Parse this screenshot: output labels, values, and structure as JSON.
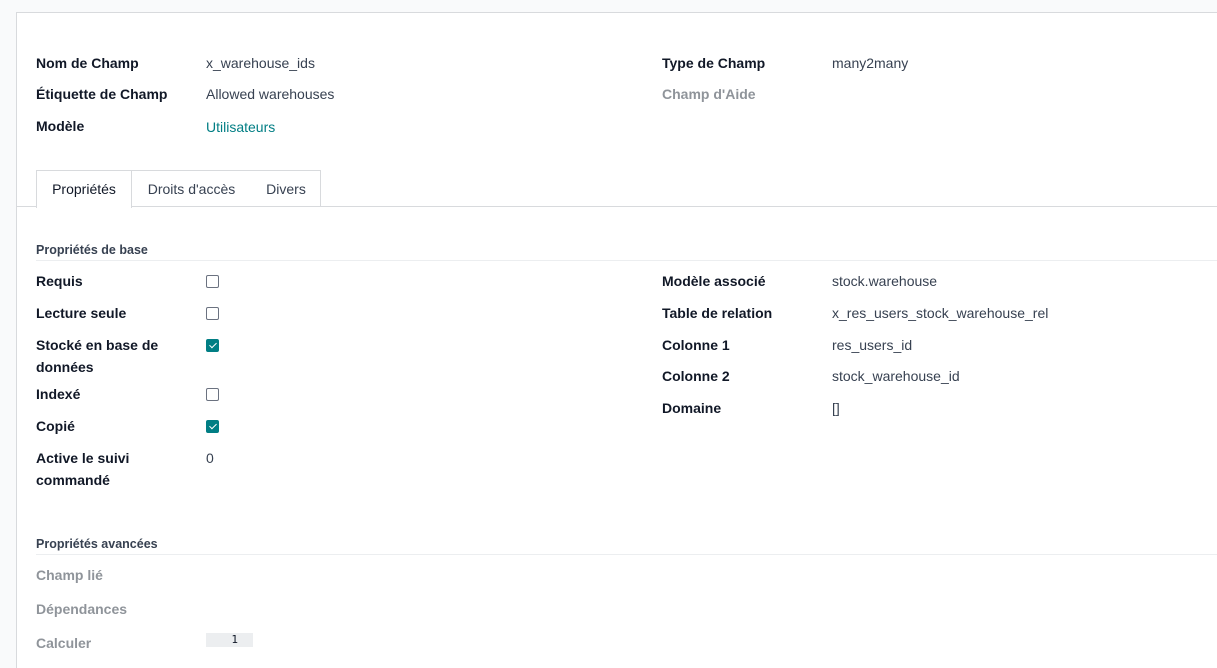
{
  "header_fields": {
    "field_name_label": "Nom de Champ",
    "field_name_value": "x_warehouse_ids",
    "field_label_label": "Étiquette de Champ",
    "field_label_value": "Allowed warehouses",
    "model_label": "Modèle",
    "model_value": "Utilisateurs",
    "field_type_label": "Type de Champ",
    "field_type_value": "many2many",
    "help_label": "Champ d'Aide"
  },
  "tabs": [
    {
      "label": "Propriétés",
      "active": true
    },
    {
      "label": "Droits d'accès",
      "active": false
    },
    {
      "label": "Divers",
      "active": false
    }
  ],
  "basic_properties": {
    "title": "Propriétés de base",
    "required": {
      "label": "Requis",
      "checked": false
    },
    "readonly": {
      "label": "Lecture seule",
      "checked": false
    },
    "stored": {
      "label_line1": "Stocké en base de",
      "label_line2": "données",
      "checked": true
    },
    "indexed": {
      "label": "Indexé",
      "checked": false
    },
    "copied": {
      "label": "Copié",
      "checked": true
    },
    "tracking": {
      "label_line1": "Active le suivi",
      "label_line2": "commandé",
      "value": "0"
    },
    "related_model_label": "Modèle associé",
    "related_model_value": "stock.warehouse",
    "relation_table_label": "Table de relation",
    "relation_table_value": "x_res_users_stock_warehouse_rel",
    "column1_label": "Colonne 1",
    "column1_value": "res_users_id",
    "column2_label": "Colonne 2",
    "column2_value": "stock_warehouse_id",
    "domain_label": "Domaine",
    "domain_value": "[]"
  },
  "advanced_properties": {
    "title": "Propriétés avancées",
    "related_field_label": "Champ lié",
    "dependencies_label": "Dépendances",
    "compute_label": "Calculer",
    "compute_line_number": "1"
  },
  "colors": {
    "accent": "#017e84",
    "muted_label": "#8f949a"
  }
}
